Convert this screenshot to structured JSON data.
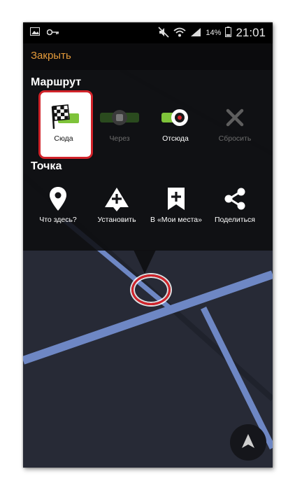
{
  "status_bar": {
    "battery_percent": "14%",
    "time": "21:01"
  },
  "header": {
    "close_label": "Закрыть"
  },
  "route_section": {
    "title": "Маршрут",
    "actions": [
      {
        "label": "Сюда",
        "icon": "checkered-flag-icon",
        "enabled": true,
        "highlighted": true
      },
      {
        "label": "Через",
        "icon": "via-point-icon",
        "enabled": false
      },
      {
        "label": "Отсюда",
        "icon": "start-point-icon",
        "enabled": true
      },
      {
        "label": "Сбросить",
        "icon": "close-icon",
        "enabled": false
      }
    ]
  },
  "point_section": {
    "title": "Точка",
    "actions": [
      {
        "label": "Что здесь?",
        "icon": "map-pin-icon"
      },
      {
        "label": "Установить",
        "icon": "add-marker-icon"
      },
      {
        "label": "В «Мои места»",
        "icon": "bookmark-add-icon"
      },
      {
        "label": "Поделиться",
        "icon": "share-icon"
      }
    ]
  },
  "colors": {
    "accent": "#e39a3a",
    "highlight": "#d1232a",
    "map_background": "#272a36",
    "road": "#6e87c4",
    "flag_green": "#7ec33a"
  }
}
